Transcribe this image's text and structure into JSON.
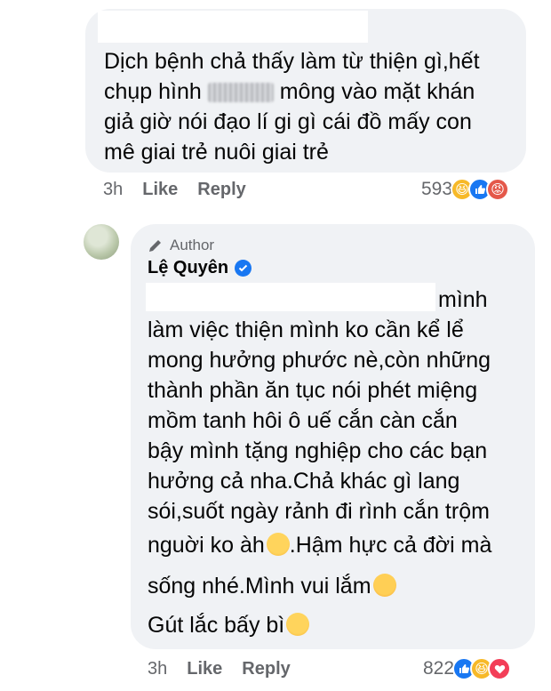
{
  "comment1": {
    "text_line1": "Dịch bệnh chả thấy làm từ thiện gì,hết",
    "text_line2_start": "chụp hình",
    "text_line2_end": "mông vào mặt khán",
    "text_line3": "giả giờ nói đạo lí gi gì cái đồ mấy con",
    "text_line4": "mê giai trẻ nuôi giai trẻ",
    "time": "3h",
    "like_label": "Like",
    "reply_label": "Reply",
    "reaction_count": "593",
    "reactions": [
      "haha-icon",
      "like-icon",
      "angry-icon"
    ]
  },
  "comment2": {
    "author_tag": "Author",
    "author_name": "Lệ Quyên",
    "lines": [
      "mình",
      "làm việc thiện mình ko cần kể lể",
      "mong hưởng phước nè,còn những",
      "thành phần ăn tục nói phét miệng",
      "mồm tanh hôi ô uế cắn càn cắn",
      "bậy mình tặng nghiệp cho các bạn",
      "hưởng cả nha.Chả khác gì lang",
      "sói,suốt ngày rảnh đi rình cắn trộm",
      "nguời ko àh",
      ".Hậm hực cả đời mà",
      "sống nhé.Mình vui lắm",
      "Gút lắc bấy bì"
    ],
    "time": "3h",
    "like_label": "Like",
    "reply_label": "Reply",
    "reaction_count": "822",
    "reactions": [
      "like-icon",
      "haha-icon",
      "love-icon"
    ]
  },
  "colors": {
    "bubble": "#f0f2f5",
    "meta_text": "#65676b",
    "like_blue": "#1877f2",
    "haha_yellow": "#f7b928",
    "angry_red": "#e4584a",
    "love_red": "#f33e58"
  }
}
